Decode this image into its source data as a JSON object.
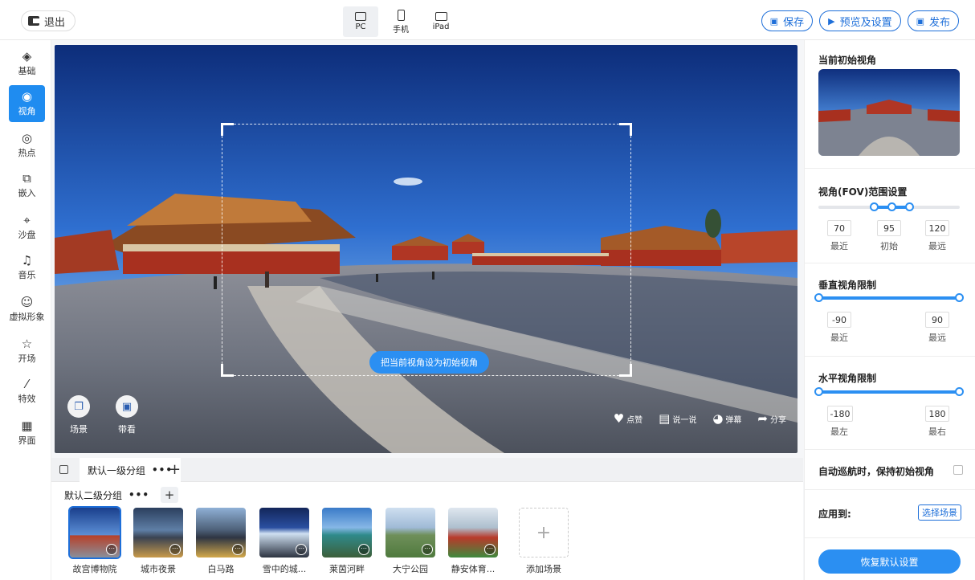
{
  "topbar": {
    "exit_label": "退出",
    "devices": [
      {
        "label": "PC",
        "icon": "monitor-icon",
        "active": true
      },
      {
        "label": "手机",
        "icon": "phone-icon",
        "active": false
      },
      {
        "label": "iPad",
        "icon": "tablet-icon",
        "active": false
      }
    ],
    "save_label": "保存",
    "preview_label": "预览及设置",
    "publish_label": "发布"
  },
  "sidebar": {
    "items": [
      {
        "label": "基础",
        "icon": "layers-icon"
      },
      {
        "label": "视角",
        "icon": "eye-icon",
        "active": true
      },
      {
        "label": "热点",
        "icon": "target-icon"
      },
      {
        "label": "嵌入",
        "icon": "embed-icon"
      },
      {
        "label": "沙盘",
        "icon": "pin-icon"
      },
      {
        "label": "音乐",
        "icon": "music-icon"
      },
      {
        "label": "虚拟形象",
        "icon": "avatar-icon"
      },
      {
        "label": "开场",
        "icon": "star-icon"
      },
      {
        "label": "特效",
        "icon": "wand-icon"
      },
      {
        "label": "界面",
        "icon": "grid-icon"
      }
    ]
  },
  "pano": {
    "set_initial_view_label": "把当前视角设为初始视角",
    "tools": [
      {
        "label": "场景",
        "icon": "scenes-icon"
      },
      {
        "label": "带看",
        "icon": "guide-icon"
      }
    ],
    "actions": [
      {
        "label": "点赞",
        "icon": "heart-icon"
      },
      {
        "label": "说一说",
        "icon": "comment-icon"
      },
      {
        "label": "弹幕",
        "icon": "danmaku-icon"
      },
      {
        "label": "分享",
        "icon": "share-icon"
      }
    ]
  },
  "scenes": {
    "group1_label": "默认一级分组",
    "group1_more": "•••",
    "group2_label": "默认二级分组",
    "group2_more": "•••",
    "items": [
      {
        "label": "故宫博物院",
        "active": true
      },
      {
        "label": "城市夜景"
      },
      {
        "label": "白马路"
      },
      {
        "label": "雪中的城..."
      },
      {
        "label": "莱茵河畔"
      },
      {
        "label": "大宁公园"
      },
      {
        "label": "静安体育..."
      }
    ],
    "add_label": "添加场景"
  },
  "right_panel": {
    "current_view_title": "当前初始视角",
    "fov": {
      "title": "视角(FOV)范围设置",
      "min": "70",
      "init": "95",
      "max": "120",
      "min_label": "最近",
      "init_label": "初始",
      "max_label": "最远"
    },
    "vertical": {
      "title": "垂直视角限制",
      "min": "-90",
      "max": "90",
      "min_label": "最近",
      "max_label": "最远"
    },
    "horizontal": {
      "title": "水平视角限制",
      "min": "-180",
      "max": "180",
      "min_label": "最左",
      "max_label": "最右"
    },
    "auto_cruise_label": "自动巡航时，保持初始视角",
    "apply_to_label": "应用到:",
    "select_scene_label": "选择场景",
    "reset_label": "恢复默认设置"
  },
  "colors": {
    "accent": "#2b8ff2",
    "accent_dark": "#1e6fd9"
  }
}
